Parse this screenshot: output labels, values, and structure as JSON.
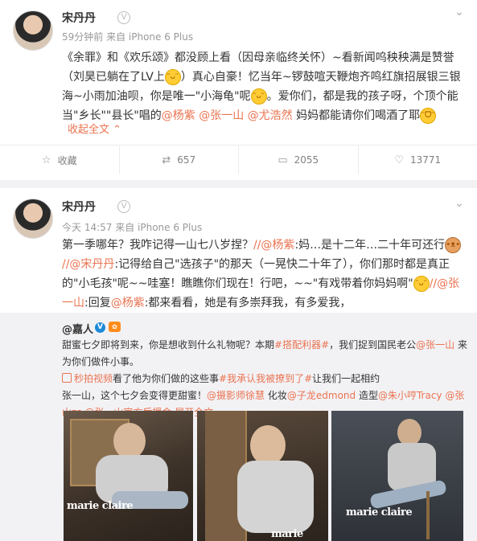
{
  "post1": {
    "user": "宋丹丹",
    "meta": "59分钟前 来自 iPhone 6 Plus",
    "line1": "《余罪》和《欢乐颂》都没顾上看（因母亲临终关怀）~看新闻呜秧秧满是赞誉",
    "line2a": "（刘昊已躺在了LV上",
    "line2b": "）真心自豪！忆当年~锣鼓喧天鞭炮齐鸣红旗招展银三银",
    "line3a": "海~小雨加油呗，你是唯一\"小海龟\"呢",
    "line3b": "。爱你们，都是我的孩子呀，个顶个能",
    "line4": "当\"乡长\"\"县长\"唱的",
    "mention_yangzi": "@杨紫",
    "mention_zhangyishan": "@张一山",
    "mention_youhaoran": "@尤浩然",
    "line4tail": "妈妈都能请你们喝酒了耶",
    "collapse": "收起全文",
    "collapse_arrow": "⌃",
    "actions": {
      "favorite": "收藏",
      "repost": "657",
      "comment": "2055",
      "like": "13771"
    }
  },
  "post2": {
    "user": "宋丹丹",
    "meta": "今天 14:57 来自 iPhone 6 Plus",
    "l1a": "第一季哪年？我咋记得一山七八岁捏？",
    "l1b": "//@杨紫",
    "l1c": ":妈…是十二年…二十年可还行",
    "l2a": "//@宋丹丹",
    "l2b": ":记得给自己\"选孩子\"的那天（一晃快二十年了），你们那时都是真正",
    "l3a": "的\"小毛孩\"呢~~哇塞！瞧瞧你们现在！行吧，~~\"有戏带着你妈妈啊\"",
    "l3b": "//@张",
    "l4a": "一山",
    "l4b": ":回复",
    "l4c": "@杨紫",
    "l4d": ":都来看看，她是有多崇拜我，有多爱我，",
    "repost": {
      "user": "@嘉人",
      "r1a": "甜蜜七夕即将到来，你是想收到什么礼物呢？本期",
      "r1b": "#搭配利器#",
      "r1c": "，我们捉到国民老公",
      "r1d": "@张一山",
      "r1e": "来",
      "r2": "为你们做件小事。",
      "r3a": "秒拍视频",
      "r3b": "看了他为你们做的这些事",
      "r3c": "#我承认我被撩到了#",
      "r3d": "让我们一起相约",
      "r4a": "张一山，这个七夕会变得更甜蜜！",
      "r4b": "@摄影师徐慧",
      "r4c": "化妆",
      "r4d": "@子龙edmond",
      "r4e": "造型",
      "r4f": "@朱小哼Tracy",
      "r4g": "@张",
      "r5a": "山zs",
      "r5b": "@张一山官方后援会",
      "r5c": "展开全文",
      "r5d": "⌄",
      "brand": "marie claire"
    }
  },
  "colors": {
    "accent": "#eb7350",
    "vip_blue": "#1c8ad8",
    "repost_bg": "#f2f2f5"
  }
}
